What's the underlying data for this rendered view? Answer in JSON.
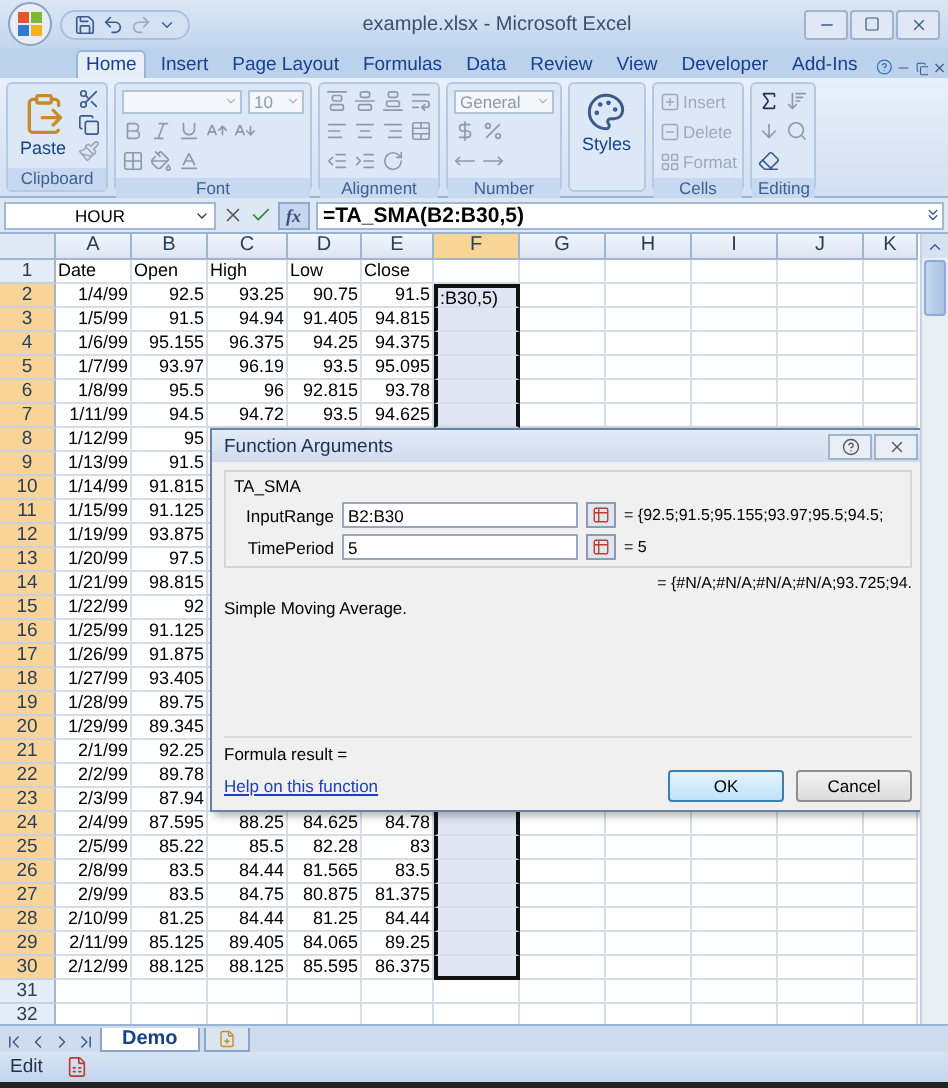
{
  "window": {
    "title": "example.xlsx - Microsoft Excel"
  },
  "ribbon": {
    "tabs": [
      {
        "label": "Home",
        "selected": true
      },
      {
        "label": "Insert",
        "selected": false
      },
      {
        "label": "Page Layout",
        "selected": false
      },
      {
        "label": "Formulas",
        "selected": false
      },
      {
        "label": "Data",
        "selected": false
      },
      {
        "label": "Review",
        "selected": false
      },
      {
        "label": "View",
        "selected": false
      },
      {
        "label": "Developer",
        "selected": false
      },
      {
        "label": "Add-Ins",
        "selected": false
      }
    ],
    "groups": [
      {
        "kind": "clipboard",
        "label": "Clipboard",
        "button": "Paste"
      },
      {
        "kind": "font",
        "label": "Font",
        "font_size": "10"
      },
      {
        "kind": "alignment",
        "label": "Alignment"
      },
      {
        "kind": "number",
        "label": "Number",
        "format": "General"
      },
      {
        "kind": "styles",
        "button": "Styles"
      },
      {
        "kind": "cells",
        "label": "Cells",
        "buttons": [
          "Insert",
          "Delete",
          "Format"
        ]
      },
      {
        "kind": "editing",
        "label": "Editing"
      }
    ]
  },
  "formula_bar": {
    "name_box": "HOUR",
    "insert_function": "fx",
    "formula": "=TA_SMA(B2:B30,5)"
  },
  "columns": [
    {
      "label": "A",
      "selected": false
    },
    {
      "label": "B",
      "selected": false
    },
    {
      "label": "C",
      "selected": false
    },
    {
      "label": "D",
      "selected": false
    },
    {
      "label": "E",
      "selected": false
    },
    {
      "label": "F",
      "selected": true
    },
    {
      "label": "G",
      "selected": false
    },
    {
      "label": "H",
      "selected": false
    },
    {
      "label": "I",
      "selected": false
    },
    {
      "label": "J",
      "selected": false
    },
    {
      "label": "K",
      "selected": false
    }
  ],
  "rows": [
    {
      "number": "1",
      "selected": false,
      "kind": "text",
      "cells": [
        "Date",
        "Open",
        "High",
        "Low",
        "Close"
      ]
    },
    {
      "number": "2",
      "selected": true,
      "kind": "number",
      "cells": [
        "1/4/99",
        "92.5",
        "93.25",
        "90.75",
        "91.5"
      ],
      "active_text": ":B30,5)"
    },
    {
      "number": "3",
      "selected": true,
      "kind": "number",
      "cells": [
        "1/5/99",
        "91.5",
        "94.94",
        "91.405",
        "94.815"
      ]
    },
    {
      "number": "4",
      "selected": true,
      "kind": "number",
      "cells": [
        "1/6/99",
        "95.155",
        "96.375",
        "94.25",
        "94.375"
      ]
    },
    {
      "number": "5",
      "selected": true,
      "kind": "number",
      "cells": [
        "1/7/99",
        "93.97",
        "96.19",
        "93.5",
        "95.095"
      ]
    },
    {
      "number": "6",
      "selected": true,
      "kind": "number",
      "cells": [
        "1/8/99",
        "95.5",
        "96",
        "92.815",
        "93.78"
      ]
    },
    {
      "number": "7",
      "selected": true,
      "kind": "number",
      "cells": [
        "1/11/99",
        "94.5",
        "94.72",
        "93.5",
        "94.625"
      ]
    },
    {
      "number": "8",
      "selected": true,
      "kind": "number",
      "cells": [
        "1/12/99",
        "95"
      ]
    },
    {
      "number": "9",
      "selected": true,
      "kind": "number",
      "cells": [
        "1/13/99",
        "91.5"
      ]
    },
    {
      "number": "10",
      "selected": true,
      "kind": "number",
      "cells": [
        "1/14/99",
        "91.815"
      ]
    },
    {
      "number": "11",
      "selected": true,
      "kind": "number",
      "cells": [
        "1/15/99",
        "91.125"
      ]
    },
    {
      "number": "12",
      "selected": true,
      "kind": "number",
      "cells": [
        "1/19/99",
        "93.875"
      ]
    },
    {
      "number": "13",
      "selected": true,
      "kind": "number",
      "cells": [
        "1/20/99",
        "97.5"
      ]
    },
    {
      "number": "14",
      "selected": true,
      "kind": "number",
      "cells": [
        "1/21/99",
        "98.815"
      ]
    },
    {
      "number": "15",
      "selected": true,
      "kind": "number",
      "cells": [
        "1/22/99",
        "92"
      ]
    },
    {
      "number": "16",
      "selected": true,
      "kind": "number",
      "cells": [
        "1/25/99",
        "91.125"
      ]
    },
    {
      "number": "17",
      "selected": true,
      "kind": "number",
      "cells": [
        "1/26/99",
        "91.875"
      ]
    },
    {
      "number": "18",
      "selected": true,
      "kind": "number",
      "cells": [
        "1/27/99",
        "93.405"
      ]
    },
    {
      "number": "19",
      "selected": true,
      "kind": "number",
      "cells": [
        "1/28/99",
        "89.75"
      ]
    },
    {
      "number": "20",
      "selected": true,
      "kind": "number",
      "cells": [
        "1/29/99",
        "89.345"
      ]
    },
    {
      "number": "21",
      "selected": true,
      "kind": "number",
      "cells": [
        "2/1/99",
        "92.25"
      ]
    },
    {
      "number": "22",
      "selected": true,
      "kind": "number",
      "cells": [
        "2/2/99",
        "89.78"
      ]
    },
    {
      "number": "23",
      "selected": true,
      "kind": "number",
      "cells": [
        "2/3/99",
        "87.94"
      ]
    },
    {
      "number": "24",
      "selected": true,
      "kind": "number",
      "cells": [
        "2/4/99",
        "87.595",
        "88.25",
        "84.625",
        "84.78"
      ]
    },
    {
      "number": "25",
      "selected": true,
      "kind": "number",
      "cells": [
        "2/5/99",
        "85.22",
        "85.5",
        "82.28",
        "83"
      ]
    },
    {
      "number": "26",
      "selected": true,
      "kind": "number",
      "cells": [
        "2/8/99",
        "83.5",
        "84.44",
        "81.565",
        "83.5"
      ]
    },
    {
      "number": "27",
      "selected": true,
      "kind": "number",
      "cells": [
        "2/9/99",
        "83.5",
        "84.75",
        "80.875",
        "81.375"
      ]
    },
    {
      "number": "28",
      "selected": true,
      "kind": "number",
      "cells": [
        "2/10/99",
        "81.25",
        "84.44",
        "81.25",
        "84.44"
      ]
    },
    {
      "number": "29",
      "selected": true,
      "kind": "number",
      "cells": [
        "2/11/99",
        "85.125",
        "89.405",
        "84.065",
        "89.25"
      ]
    },
    {
      "number": "30",
      "selected": true,
      "kind": "number",
      "cells": [
        "2/12/99",
        "88.125",
        "88.125",
        "85.595",
        "86.375"
      ]
    },
    {
      "number": "31",
      "selected": false,
      "kind": "number"
    },
    {
      "number": "32",
      "selected": false,
      "kind": "number"
    }
  ],
  "dialog": {
    "title": "Function Arguments",
    "function_name": "TA_SMA",
    "arguments": [
      {
        "label": "InputRange",
        "value": "B2:B30",
        "result": "= {92.5;91.5;95.155;93.97;95.5;94.5;"
      },
      {
        "label": "TimePeriod",
        "value": "5",
        "result": "= 5"
      }
    ],
    "function_result": "= {#N/A;#N/A;#N/A;#N/A;93.725;94.",
    "description": "Simple Moving Average.",
    "formula_result": "Formula result =",
    "help_link": "Help on this function",
    "buttons": [
      {
        "label": "OK",
        "default": true
      },
      {
        "label": "Cancel",
        "default": false
      }
    ]
  },
  "sheet_tabs": [
    {
      "label": "Demo",
      "selected": true
    }
  ],
  "status_bar": {
    "mode": "Edit"
  }
}
